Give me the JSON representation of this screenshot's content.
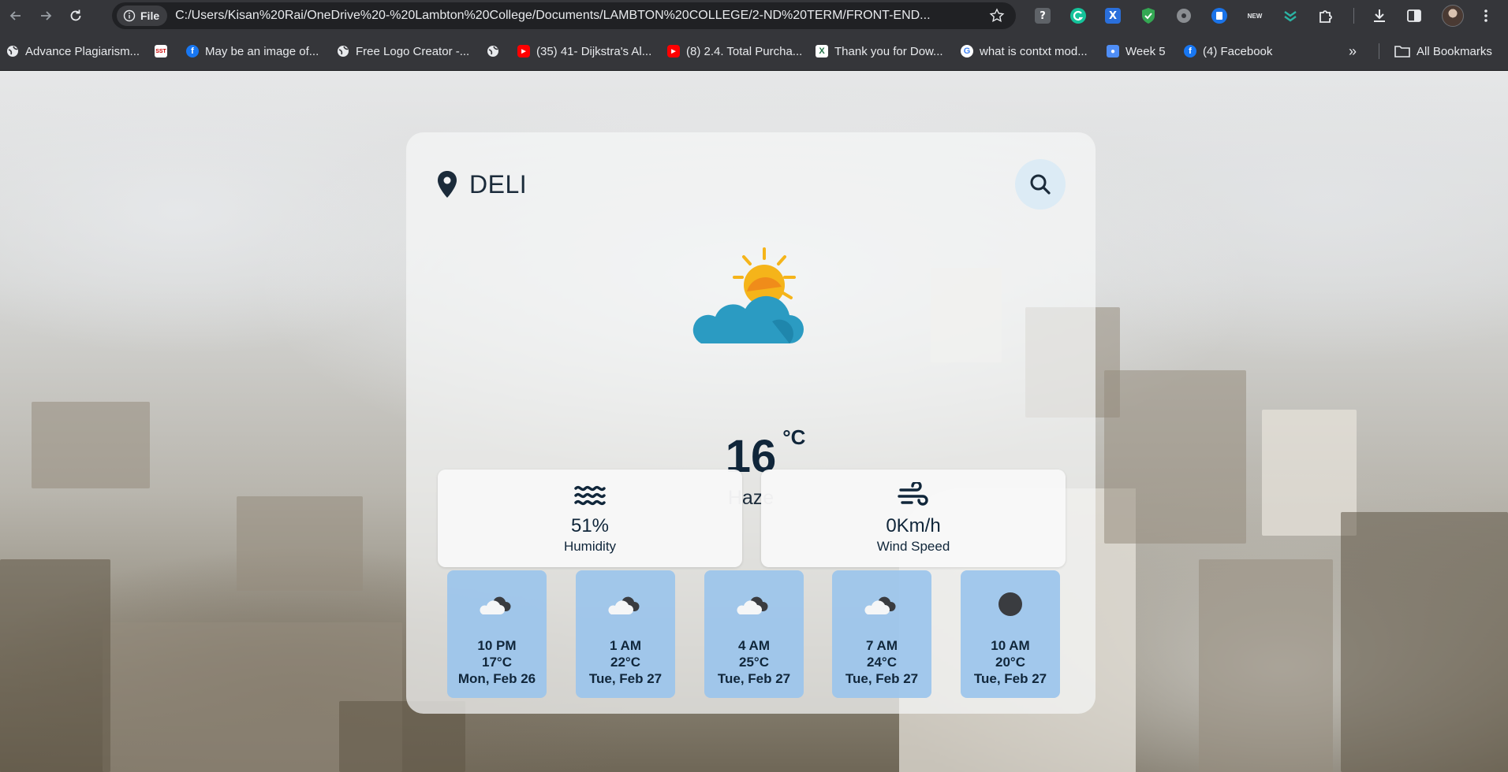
{
  "browser": {
    "site_chip_label": "File",
    "url": "C:/Users/Kisan%20Rai/OneDrive%20-%20Lambton%20College/Documents/LAMBTON%20COLLEGE/2-ND%20TERM/FRONT-END...",
    "bookmarks": [
      {
        "label": "Advance Plagiarism...",
        "icon": "globe-icon"
      },
      {
        "label": "",
        "icon": "sst-icon",
        "badge": "SST"
      },
      {
        "label": "May be an image of...",
        "icon": "facebook-icon"
      },
      {
        "label": "Free Logo Creator -...",
        "icon": "globe-icon"
      },
      {
        "label": "",
        "icon": "globe-icon"
      },
      {
        "label": "(35) 41- Dijkstra's Al...",
        "icon": "youtube-icon"
      },
      {
        "label": "(8) 2.4. Total Purcha...",
        "icon": "youtube-icon"
      },
      {
        "label": "Thank you for Dow...",
        "icon": "x-icon"
      },
      {
        "label": "what is contxt mod...",
        "icon": "google-icon"
      },
      {
        "label": "Week 5",
        "icon": "person-icon"
      },
      {
        "label": "(4) Facebook",
        "icon": "facebook-icon"
      }
    ],
    "all_bookmarks_label": "All Bookmarks",
    "extensions": [
      "question-icon",
      "grammarly-icon",
      "x-ext-icon",
      "shield-check-icon",
      "music-icon",
      "doc-icon",
      "new-badge-icon",
      "pin-ext-icon",
      "puzzle-icon"
    ],
    "new_badge": "NEW"
  },
  "weather": {
    "city": "DELI",
    "temperature": "16",
    "unit": "°C",
    "condition": "Haze",
    "humidity": {
      "value": "51%",
      "label": "Humidity",
      "icon": "waves-icon"
    },
    "wind": {
      "value": "0Km/h",
      "label": "Wind Speed",
      "icon": "wind-icon"
    },
    "forecast": [
      {
        "time": "10 PM",
        "temp": "17°C",
        "date": "Mon, Feb 26",
        "icon": "cloud-icon"
      },
      {
        "time": "1 AM",
        "temp": "22°C",
        "date": "Tue, Feb 27",
        "icon": "cloud-icon"
      },
      {
        "time": "4 AM",
        "temp": "25°C",
        "date": "Tue, Feb 27",
        "icon": "cloud-icon"
      },
      {
        "time": "7 AM",
        "temp": "24°C",
        "date": "Tue, Feb 27",
        "icon": "cloud-icon"
      },
      {
        "time": "10 AM",
        "temp": "20°C",
        "date": "Tue, Feb 27",
        "icon": "dark-circle-icon"
      }
    ]
  },
  "colors": {
    "accent": "#10263a",
    "forecast_card": "#9bc4ec",
    "search_button": "#dcebf5"
  }
}
